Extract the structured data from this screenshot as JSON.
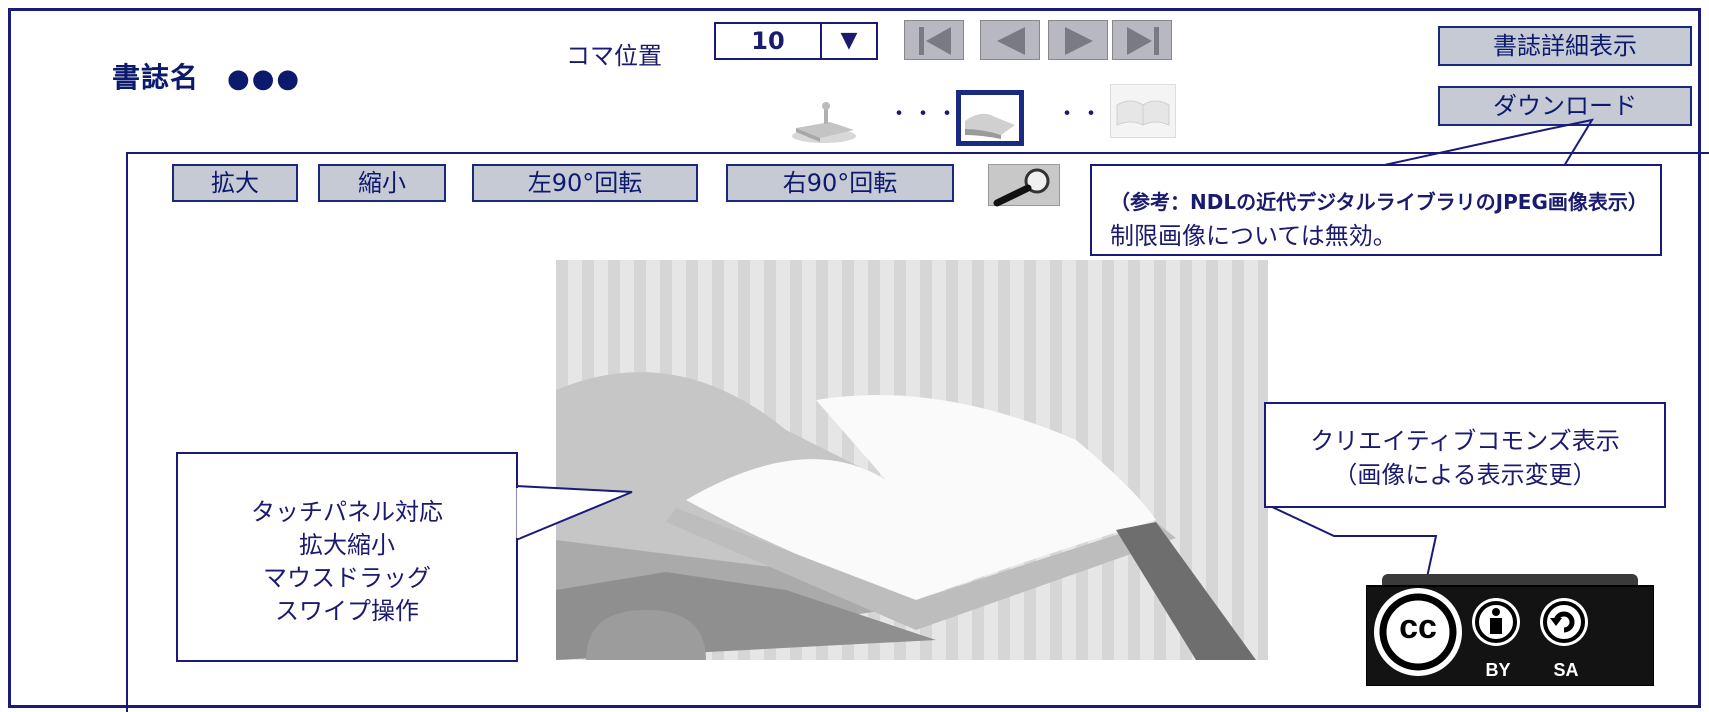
{
  "header": {
    "book_title_label": "書誌名",
    "book_title_value": "●●●",
    "frame_position_label": "コマ位置",
    "frame_position_value": "10",
    "frame_dropdown_glyph": "▼"
  },
  "buttons": {
    "bib_detail": "書誌詳細表示",
    "download": "ダウンロード",
    "zoom_in": "拡大",
    "zoom_out": "縮小",
    "rotate_left": "左90°回転",
    "rotate_right": "右90°回転"
  },
  "thumbnails": {
    "ellipsis_left": "・・・",
    "ellipsis_right": "・・・"
  },
  "notes": {
    "download_line1": "（参考：NDLの近代デジタルライブラリのJPEG画像表示）",
    "download_line2": "制限画像については無効。",
    "touch_line1": "タッチパネル対応",
    "touch_line2": "拡大縮小",
    "touch_line3": "マウスドラッグ",
    "touch_line4": "スワイプ操作",
    "cc_line1": "クリエイティブコモンズ表示",
    "cc_line2": "（画像による表示変更）"
  },
  "license": {
    "cc": "cc",
    "by": "BY",
    "sa": "SA"
  },
  "icons": {
    "first": "first-page-icon",
    "prev": "prev-page-icon",
    "next": "next-page-icon",
    "last": "last-page-icon",
    "search": "magnifier-icon"
  }
}
